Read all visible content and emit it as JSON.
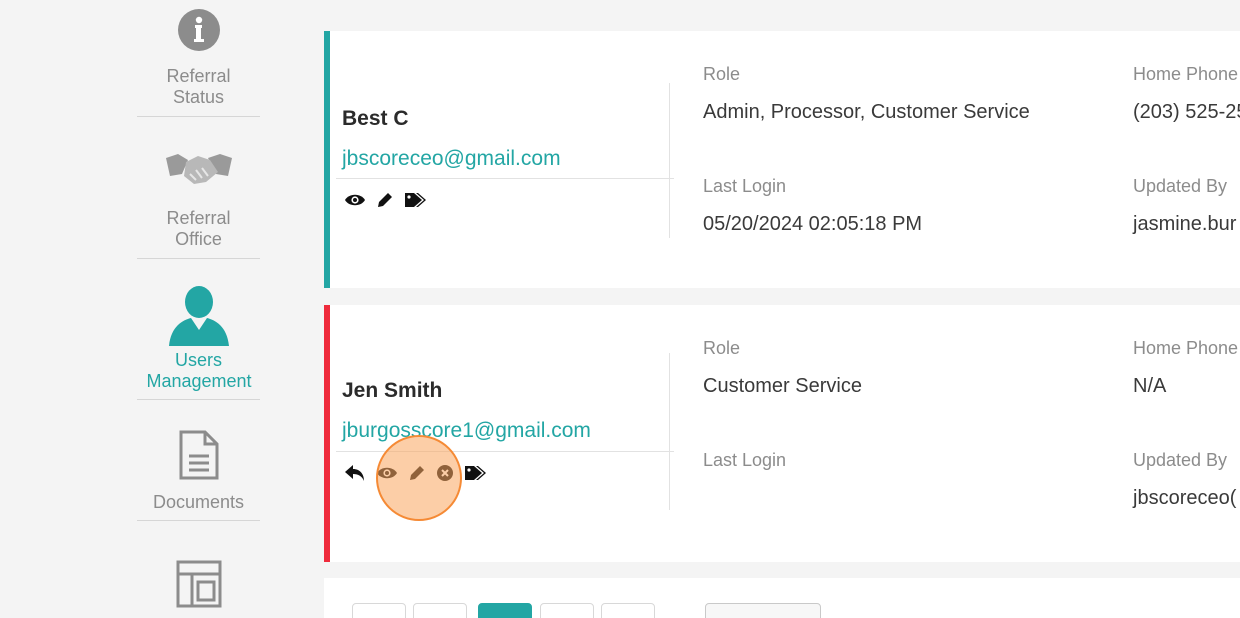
{
  "sidebar": {
    "items": [
      {
        "label_line1": "Referral",
        "label_line2": "Status",
        "icon": "info-circle-icon"
      },
      {
        "label_line1": "Referral",
        "label_line2": "Office",
        "icon": "handshake-icon"
      },
      {
        "label_line1": "Users",
        "label_line2": "Management",
        "icon": "user-icon"
      },
      {
        "label_line1": "Documents",
        "icon": "document-icon"
      },
      {
        "icon": "template-icon"
      }
    ]
  },
  "users": [
    {
      "name": "Best C",
      "email": "jbscoreceo@gmail.com",
      "role_label": "Role",
      "role": "Admin, Processor, Customer Service",
      "home_phone_label": "Home Phone",
      "home_phone": "(203) 525-25",
      "last_login_label": "Last Login",
      "last_login": "05/20/2024 02:05:18 PM",
      "updated_by_label": "Updated By",
      "updated_by": "jasmine.bur",
      "status_color": "#23a6a4"
    },
    {
      "name": "Jen Smith",
      "email": "jburgosscore1@gmail.com",
      "role_label": "Role",
      "role": "Customer Service",
      "home_phone_label": "Home Phone",
      "home_phone": "N/A",
      "last_login_label": "Last Login",
      "last_login": "",
      "updated_by_label": "Updated By",
      "updated_by": "jbscoreceo(",
      "status_color": "#ef2b3c"
    }
  ],
  "colors": {
    "accent": "#23a6a4",
    "danger": "#ef2b3c",
    "highlight": "#f58a35"
  },
  "pagination": {
    "active_page": 3
  }
}
